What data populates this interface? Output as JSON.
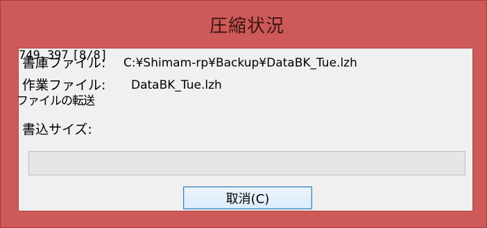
{
  "window": {
    "title": "圧縮状況"
  },
  "archive": {
    "label": "書庫ファイル:",
    "value": "C:¥Shimam-rp¥Backup¥DataBK_Tue.lzh"
  },
  "working": {
    "label": "作業ファイル:",
    "value": "DataBK_Tue.lzh"
  },
  "status_text": "ファイルの転送",
  "write_size": {
    "label": "書込サイズ:",
    "value": "749,397",
    "count": "[8/8]"
  },
  "progress": {
    "fraction": 0
  },
  "buttons": {
    "cancel": "取消(C)"
  },
  "colors": {
    "titlebar": "#cd5a58",
    "client": "#f0f0f0",
    "button_border": "#3c7fb1"
  }
}
